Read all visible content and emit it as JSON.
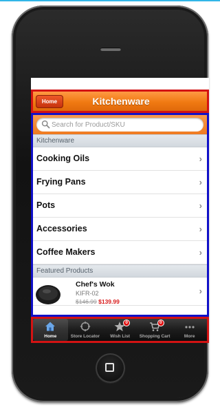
{
  "header": {
    "back_label": "Home",
    "title": "Kitchenware"
  },
  "search": {
    "placeholder": "Search for Product/SKU"
  },
  "categories": {
    "section_title": "Kitchenware",
    "items": [
      {
        "label": "Cooking Oils"
      },
      {
        "label": "Frying Pans"
      },
      {
        "label": "Pots"
      },
      {
        "label": "Accessories"
      },
      {
        "label": "Coffee Makers"
      }
    ]
  },
  "featured": {
    "section_title": "Featured Products",
    "items": [
      {
        "name": "Chef's Wok",
        "sku": "KIFR-02",
        "old_price": "$146.99",
        "price": "$139.99"
      }
    ]
  },
  "tabbar": {
    "tabs": [
      {
        "label": "Home",
        "icon": "home-icon",
        "active": true
      },
      {
        "label": "Store Locator",
        "icon": "store-locator-icon"
      },
      {
        "label": "Wish List",
        "icon": "star-icon",
        "badge": "0"
      },
      {
        "label": "Shopping Cart",
        "icon": "cart-icon",
        "badge": "0"
      },
      {
        "label": "More",
        "icon": "more-icon"
      }
    ]
  },
  "colors": {
    "accent_orange": "#f07a12",
    "outline_red": "#d31313",
    "outline_blue": "#1010c8",
    "page_accent": "#31b6e7"
  }
}
